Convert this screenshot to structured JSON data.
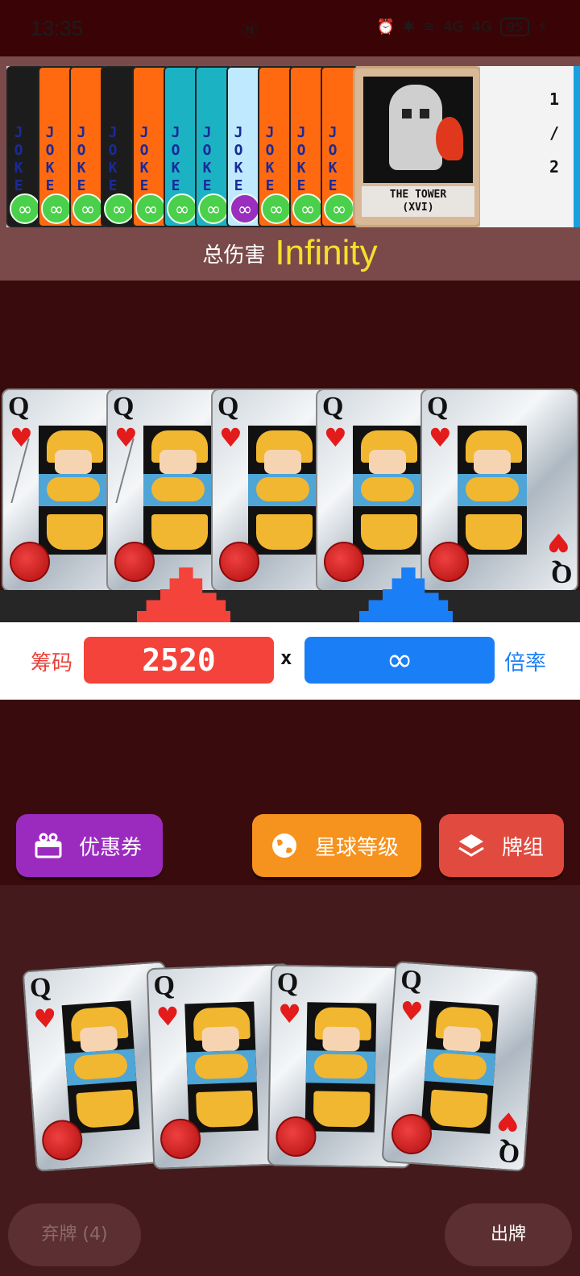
{
  "status_bar": {
    "time": "13:35",
    "battery": "95",
    "network_1": "4G",
    "network_2": "4G"
  },
  "jokers": [
    {
      "text": "JOKE",
      "bg": "#1c1c1c",
      "edition": "∞",
      "edition_type": "green"
    },
    {
      "text": "JOKE",
      "bg": "#ff6a10",
      "edition": "∞",
      "edition_type": "green"
    },
    {
      "text": "JOKE",
      "bg": "#ff6a10",
      "edition": "∞",
      "edition_type": "green"
    },
    {
      "text": "JOKE",
      "bg": "#1c1c1c",
      "edition": "∞",
      "edition_type": "green"
    },
    {
      "text": "JOKE",
      "bg": "#ff6a10",
      "edition": "∞",
      "edition_type": "green"
    },
    {
      "text": "JOKE",
      "bg": "#1bb3c4",
      "edition": "∞",
      "edition_type": "green"
    },
    {
      "text": "JOKE",
      "bg": "#1bb3c4",
      "edition": "∞",
      "edition_type": "green"
    },
    {
      "text": "JOKE",
      "bg": "#bfe9ff",
      "edition": "∞",
      "edition_type": "poly"
    },
    {
      "text": "JOKE",
      "bg": "#ff6a10",
      "edition": "∞",
      "edition_type": "green"
    },
    {
      "text": "JOKE",
      "bg": "#ff6a10",
      "edition": "∞",
      "edition_type": "green"
    },
    {
      "text": "JOKE",
      "bg": "#ff6a10",
      "edition": "∞",
      "edition_type": "green"
    }
  ],
  "tarot_card": {
    "name_line1": "THE TOWER",
    "name_line2": "(XVI)"
  },
  "consumable_slots": {
    "current": "1",
    "separator": "/",
    "max": "2"
  },
  "total_damage": {
    "label": "总伤害",
    "value": "Infinity"
  },
  "played_cards": [
    {
      "rank": "Q",
      "suit": "♥",
      "cracked": true
    },
    {
      "rank": "Q",
      "suit": "♥",
      "cracked": true
    },
    {
      "rank": "Q",
      "suit": "♥",
      "cracked": false
    },
    {
      "rank": "Q",
      "suit": "♥",
      "cracked": false
    },
    {
      "rank": "Q",
      "suit": "♥",
      "cracked": false
    }
  ],
  "score": {
    "chips_label": "筹码",
    "chips_value": "2520",
    "times": "x",
    "mult_value": "∞",
    "mult_label": "倍率"
  },
  "buttons": {
    "voucher": "优惠券",
    "planet": "星球等级",
    "deck": "牌组",
    "discard": "弃牌 (4)",
    "play": "出牌"
  },
  "hand_cards": [
    {
      "rank": "Q",
      "suit": "♥"
    },
    {
      "rank": "Q",
      "suit": "♥"
    },
    {
      "rank": "Q",
      "suit": "♥"
    },
    {
      "rank": "Q",
      "suit": "♥"
    }
  ],
  "colors": {
    "chips": "#f4433a",
    "mult": "#1a7ef7",
    "total_value": "#f4e02b",
    "voucher": "#9b2bbf",
    "planet": "#f6921e",
    "deck": "#e14a3e"
  },
  "icons": {
    "voucher": "gift-icon",
    "planet": "globe-icon",
    "deck": "layers-icon"
  }
}
